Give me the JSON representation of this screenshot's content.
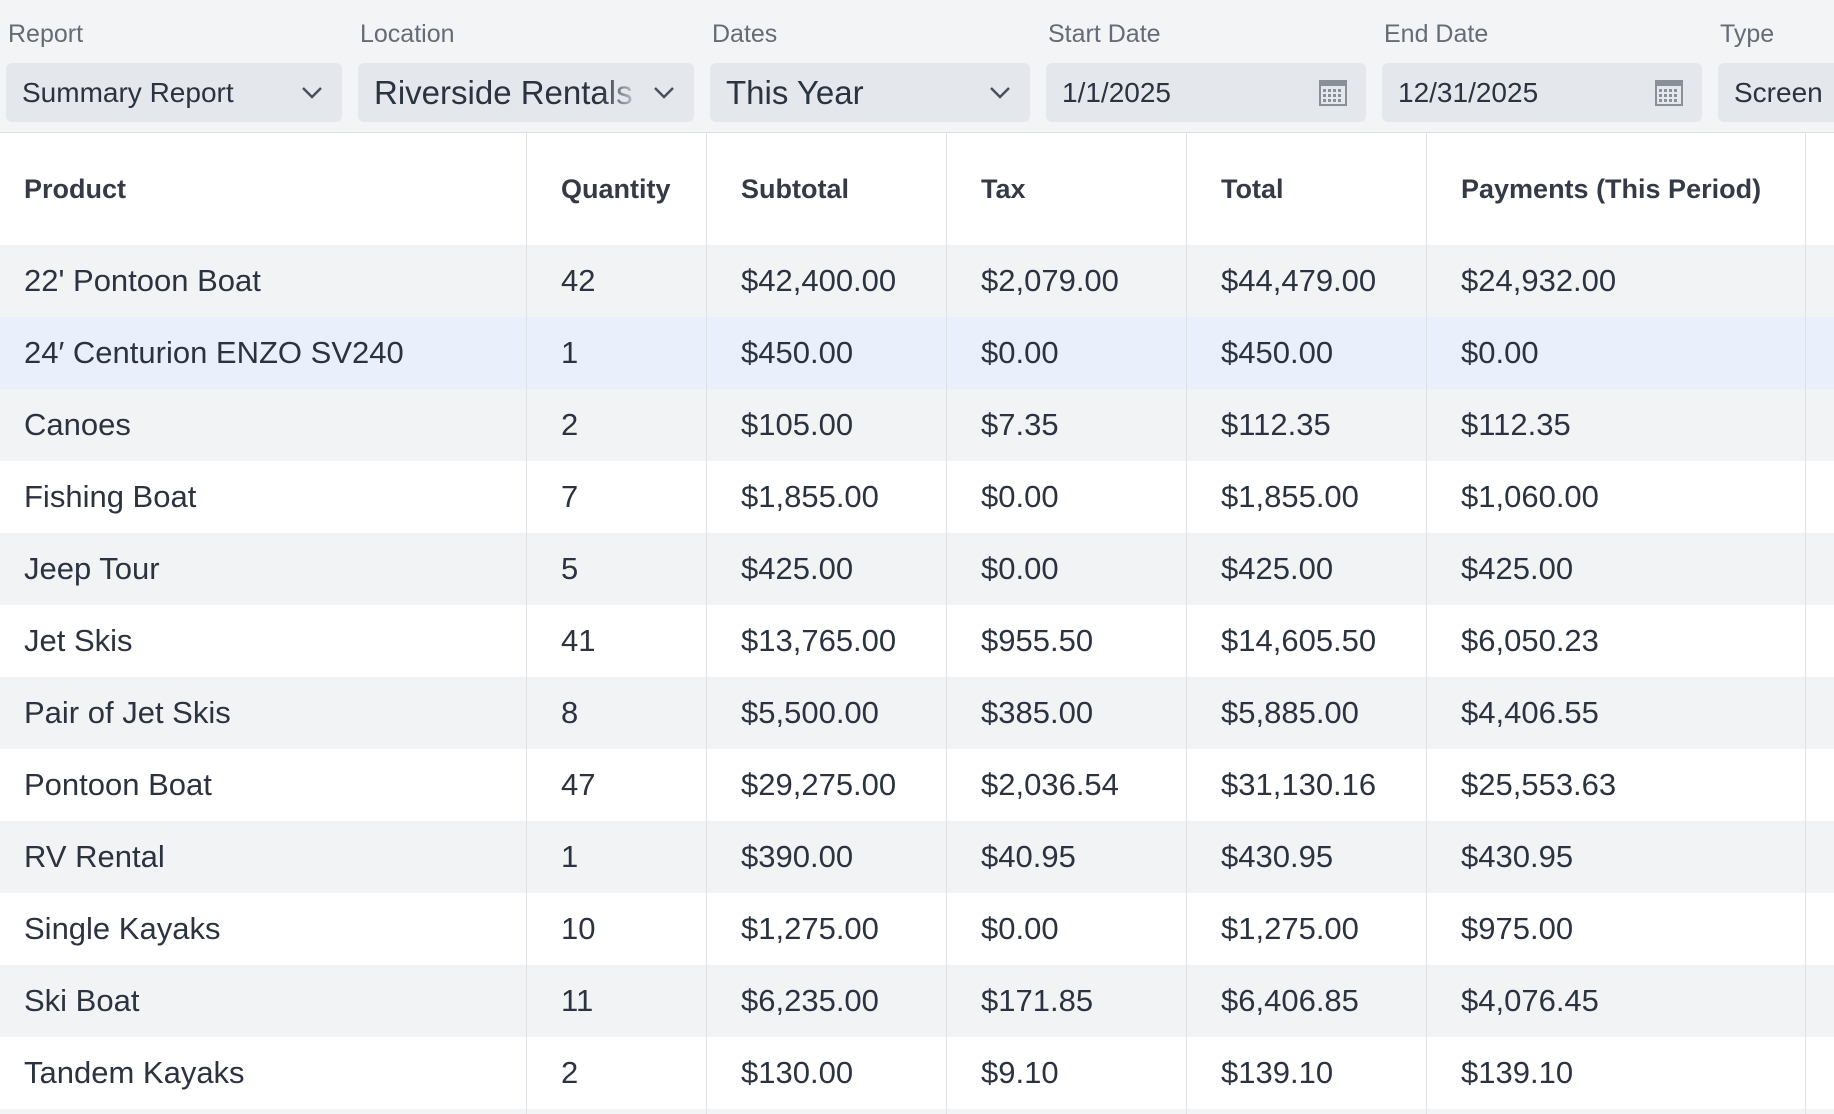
{
  "filters": {
    "report": {
      "label": "Report",
      "value": "Summary Report"
    },
    "location": {
      "label": "Location",
      "value": "Riverside Rentals"
    },
    "dates": {
      "label": "Dates",
      "value": "This Year"
    },
    "start_date": {
      "label": "Start Date",
      "value": "1/1/2025"
    },
    "end_date": {
      "label": "End Date",
      "value": "12/31/2025"
    },
    "type": {
      "label": "Type",
      "value": "Screen"
    }
  },
  "table": {
    "columns": [
      "Product",
      "Quantity",
      "Subtotal",
      "Tax",
      "Total",
      "Payments (This Period)"
    ],
    "rows": [
      [
        "22' Pontoon Boat",
        "42",
        "$42,400.00",
        "$2,079.00",
        "$44,479.00",
        "$24,932.00"
      ],
      [
        "24′ Centurion ENZO SV240",
        "1",
        "$450.00",
        "$0.00",
        "$450.00",
        "$0.00"
      ],
      [
        "Canoes",
        "2",
        "$105.00",
        "$7.35",
        "$112.35",
        "$112.35"
      ],
      [
        "Fishing Boat",
        "7",
        "$1,855.00",
        "$0.00",
        "$1,855.00",
        "$1,060.00"
      ],
      [
        "Jeep Tour",
        "5",
        "$425.00",
        "$0.00",
        "$425.00",
        "$425.00"
      ],
      [
        "Jet Skis",
        "41",
        "$13,765.00",
        "$955.50",
        "$14,605.50",
        "$6,050.23"
      ],
      [
        "Pair of Jet Skis",
        "8",
        "$5,500.00",
        "$385.00",
        "$5,885.00",
        "$4,406.55"
      ],
      [
        "Pontoon Boat",
        "47",
        "$29,275.00",
        "$2,036.54",
        "$31,130.16",
        "$25,553.63"
      ],
      [
        "RV Rental",
        "1",
        "$390.00",
        "$40.95",
        "$430.95",
        "$430.95"
      ],
      [
        "Single Kayaks",
        "10",
        "$1,275.00",
        "$0.00",
        "$1,275.00",
        "$975.00"
      ],
      [
        "Ski Boat",
        "11",
        "$6,235.00",
        "$171.85",
        "$6,406.85",
        "$4,076.45"
      ],
      [
        "Tandem Kayaks",
        "2",
        "$130.00",
        "$9.10",
        "$139.10",
        "$139.10"
      ]
    ],
    "highlighted_row": 1
  },
  "colors": {
    "background": "#f3f4f6",
    "field": "#e4e7ec",
    "row_alt": "#f2f3f5",
    "row_highlight": "#e9f0fb",
    "text": "#2b3340",
    "label": "#656c77"
  },
  "icons": {
    "dropdown": "chevron-down-icon",
    "date_picker": "calendar-icon"
  }
}
